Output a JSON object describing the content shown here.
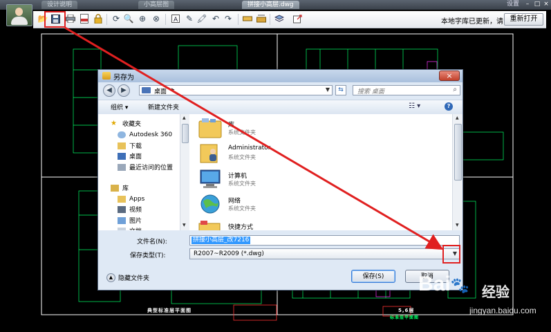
{
  "app": {
    "tabs": [
      {
        "label": "设计说明"
      },
      {
        "label": "小高层图"
      },
      {
        "label": "拼接小高层.dwg"
      }
    ],
    "settings_label": "设置",
    "update_text": "本地字库已更新，请",
    "reopen_label": "重新打开",
    "cad_captions": {
      "left": "典型标准层平面图",
      "right": "5,6层",
      "right_sub": "标准层平面图"
    }
  },
  "dialog": {
    "title": "另存为",
    "address_location": "桌面",
    "search_placeholder": "搜索 桌面",
    "organize_label": "组织",
    "new_folder_label": "新建文件夹",
    "tree": [
      {
        "label": "收藏夹",
        "icon": "star-icon"
      },
      {
        "label": "Autodesk 360",
        "icon": "cloud-icon"
      },
      {
        "label": "下载",
        "icon": "folder-icon"
      },
      {
        "label": "桌面",
        "icon": "desktop-icon"
      },
      {
        "label": "最近访问的位置",
        "icon": "recent-icon"
      },
      {
        "label": "库",
        "icon": "library-icon"
      },
      {
        "label": "Apps",
        "icon": "folder-icon"
      },
      {
        "label": "视频",
        "icon": "video-icon"
      },
      {
        "label": "图片",
        "icon": "picture-icon"
      },
      {
        "label": "文档",
        "icon": "document-icon"
      }
    ],
    "files": [
      {
        "name": "库",
        "desc": "系统文件夹"
      },
      {
        "name": "Administrator",
        "desc": "系统文件夹"
      },
      {
        "name": "计算机",
        "desc": "系统文件夹"
      },
      {
        "name": "网络",
        "desc": "系统文件夹"
      },
      {
        "name": "快捷方式",
        "desc": ""
      }
    ],
    "filename_label": "文件名(N):",
    "filename_value": "拼接小高层_改7216",
    "filetype_label": "保存类型(T):",
    "filetype_value": "R2007~R2009 (*.dwg)",
    "hide_folders_label": "隐藏文件夹",
    "save_label": "保存(S)",
    "cancel_label": "取消"
  },
  "watermark": {
    "brand": "Bai",
    "brand_suffix": "经验",
    "url": "jingyan.baidu.com"
  },
  "colors": {
    "highlight": "#e02020",
    "cad_green": "#00ff66",
    "cad_white": "#ffffff",
    "cad_magenta": "#ff33ff"
  }
}
